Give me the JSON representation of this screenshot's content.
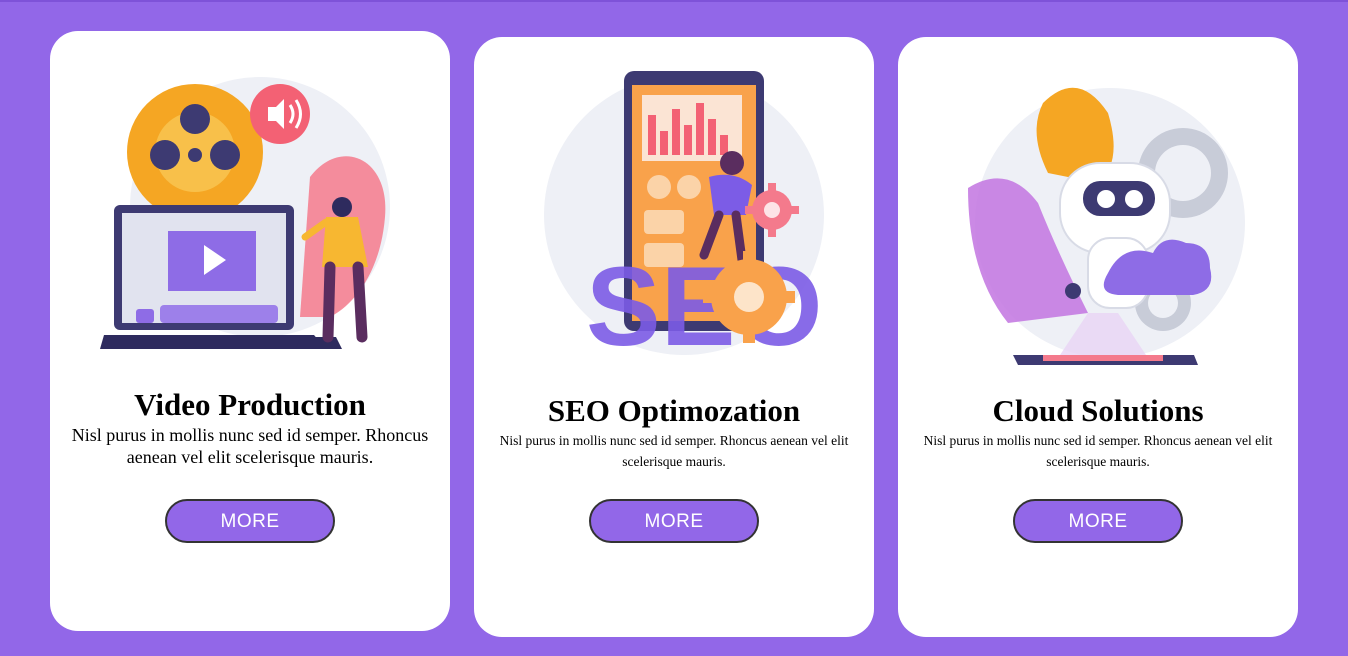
{
  "colors": {
    "background": "#9267e8",
    "card": "#ffffff",
    "button": "#9267e8",
    "button_text": "#ffffff",
    "button_border": "#333333"
  },
  "cards": [
    {
      "title": "Video Production",
      "description": "Nisl purus in mollis nunc sed id semper. Rhoncus aenean vel elit scelerisque mauris.",
      "button_label": "MORE",
      "illustration": "video-production-illustration"
    },
    {
      "title": "SEO Optimozation",
      "description": "Nisl purus in mollis nunc sed id semper. Rhoncus aenean vel elit scelerisque mauris.",
      "button_label": "MORE",
      "illustration": "seo-illustration",
      "illustration_text": "SEO"
    },
    {
      "title": "Cloud Solutions",
      "description": "Nisl purus in mollis nunc sed id semper. Rhoncus aenean vel elit scelerisque mauris.",
      "button_label": "MORE",
      "illustration": "cloud-robot-illustration"
    }
  ]
}
